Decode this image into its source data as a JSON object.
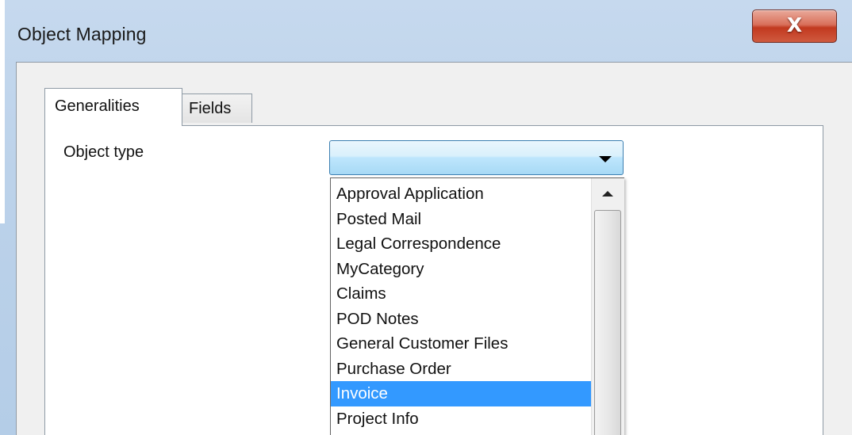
{
  "window": {
    "title": "Object Mapping",
    "close_label": "X"
  },
  "tabs": [
    {
      "label": "Generalities",
      "active": true
    },
    {
      "label": "Fields",
      "active": false
    }
  ],
  "form": {
    "object_type_label": "Object type",
    "object_type_value": ""
  },
  "dropdown": {
    "items": [
      "Approval Application",
      "Posted Mail",
      "Legal Correspondence",
      "MyCategory",
      "Claims",
      "POD Notes",
      "General Customer Files",
      "Purchase Order",
      "Invoice",
      "Project Info"
    ],
    "highlighted_item": "Invoice"
  },
  "colors": {
    "selection": "#3399ff",
    "combo_border": "#3c7fb1",
    "close_button": "#c2391f"
  }
}
